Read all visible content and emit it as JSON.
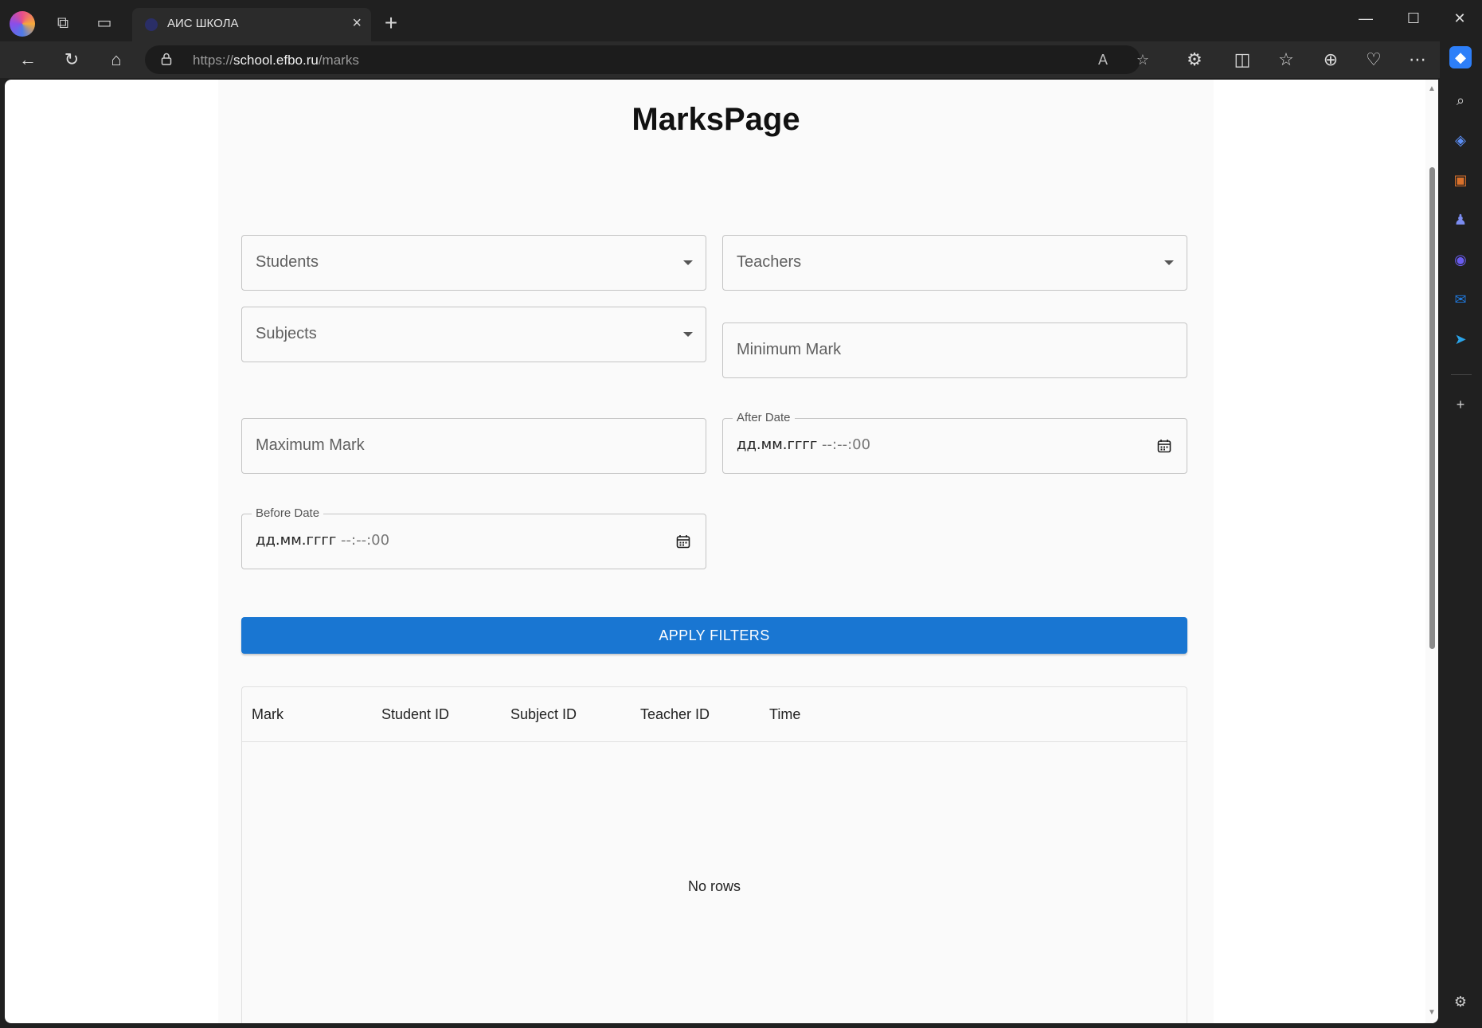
{
  "browser": {
    "tab_title": "АИС ШКОЛА",
    "url_scheme": "https://",
    "url_host": "school.efbo.ru",
    "url_path": "/marks"
  },
  "page": {
    "title": "MarksPage"
  },
  "filters": {
    "students_placeholder": "Students",
    "teachers_placeholder": "Teachers",
    "subjects_placeholder": "Subjects",
    "minimum_mark_placeholder": "Minimum Mark",
    "maximum_mark_placeholder": "Maximum Mark",
    "after_date_label": "After Date",
    "after_date_value_main": "дд.мм.гггг",
    "after_date_value_rest": " --:--:00",
    "before_date_label": "Before Date",
    "before_date_value_main": "дд.мм.гггг",
    "before_date_value_rest": " --:--:00",
    "apply_label": "APPLY FILTERS"
  },
  "table": {
    "columns": [
      "Mark",
      "Student ID",
      "Subject ID",
      "Teacher ID",
      "Time"
    ],
    "empty_text": "No rows"
  },
  "colors": {
    "primary": "#1976d2",
    "browser_chrome": "#202020"
  }
}
